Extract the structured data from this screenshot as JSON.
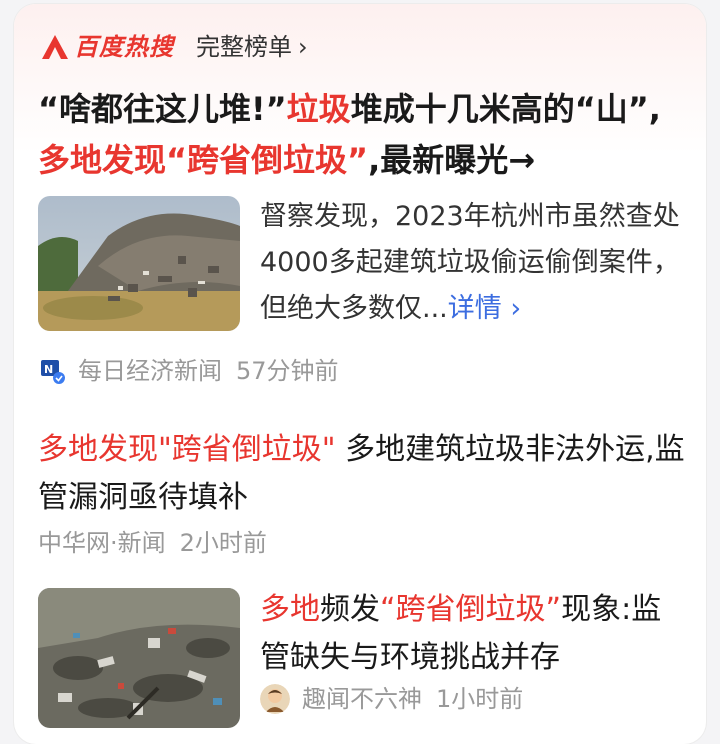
{
  "header": {
    "brand": "百度热搜",
    "full_list": "完整榜单",
    "chevron": "›"
  },
  "headline": {
    "part1": "“啥都往这儿堆!”",
    "hl1": "垃圾",
    "part2": "堆成十几米高的“山”,",
    "hl2": "多地发现“跨省倒垃圾”",
    "part3": ",最新曝光→"
  },
  "article1": {
    "summary": "督察发现，2023年杭州市虽然查处4000多起建筑垃圾偷运偷倒案件，但绝大多数仅...",
    "detail_link": "详情 ›",
    "source": "每日经济新闻",
    "time": "57分钟前"
  },
  "article2": {
    "hl": "多地发现\"跨省倒垃圾\"",
    "rest": " 多地建筑垃圾非法外运,监管漏洞亟待填补",
    "source": "中华网·新闻",
    "time": "2小时前"
  },
  "article3": {
    "hl1": "多地",
    "mid1": "频发",
    "hl2": "“跨省倒垃圾”",
    "rest": "现象:监管缺失与环境挑战并存",
    "source": "趣闻不六神",
    "time": "1小时前"
  },
  "colors": {
    "accent": "#e8362f",
    "link": "#3c6de0",
    "meta": "#999999"
  },
  "icons": [
    "baidu-hot-logo-icon",
    "chevron-right-icon",
    "mrjjxw-logo-icon",
    "verified-badge-icon",
    "author-avatar-icon"
  ]
}
